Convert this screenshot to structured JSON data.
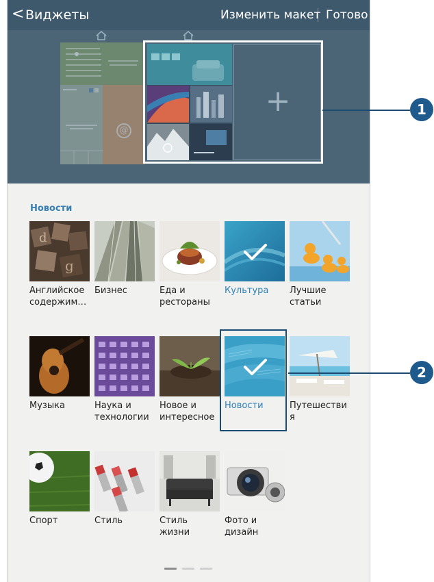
{
  "actionbar": {
    "back_glyph": "<",
    "title": "Виджеты",
    "change_layout": "Изменить макет",
    "done": "Готово",
    "bg": "#3f596c"
  },
  "preview": {
    "add_glyph": "+",
    "home_icon": "home-icon",
    "at_glyph": "@"
  },
  "section": {
    "title": "Новости"
  },
  "categories": [
    {
      "label": "Английское содержим…",
      "selected": false,
      "icon": "letters-photo"
    },
    {
      "label": "Бизнес",
      "selected": false,
      "icon": "skyscrapers-photo"
    },
    {
      "label": "Еда и рестораны",
      "selected": false,
      "icon": "food-photo"
    },
    {
      "label": "Культура",
      "selected": true,
      "icon": "culture-photo"
    },
    {
      "label": "Лучшие статьи",
      "selected": false,
      "icon": "ducks-photo"
    },
    {
      "label": "Музыка",
      "selected": false,
      "icon": "guitar-photo"
    },
    {
      "label": "Наука и технологии",
      "selected": false,
      "icon": "tech-photo"
    },
    {
      "label": "Новое и интересное",
      "selected": false,
      "icon": "plant-photo"
    },
    {
      "label": "Новости",
      "selected": true,
      "icon": "newspaper-photo"
    },
    {
      "label": "Путешестви я",
      "selected": false,
      "icon": "beach-photo"
    },
    {
      "label": "Спорт",
      "selected": false,
      "icon": "soccer-photo"
    },
    {
      "label": "Стиль",
      "selected": false,
      "icon": "lipstick-photo"
    },
    {
      "label": "Стиль жизни",
      "selected": false,
      "icon": "sofa-photo"
    },
    {
      "label": "Фото и дизайн",
      "selected": false,
      "icon": "camera-photo"
    }
  ],
  "callouts": {
    "one": "1",
    "two": "2"
  },
  "colors": {
    "accent": "#2d80b7",
    "callout": "#1f5a8c"
  },
  "pager": {
    "pages": 3,
    "current": 1
  }
}
